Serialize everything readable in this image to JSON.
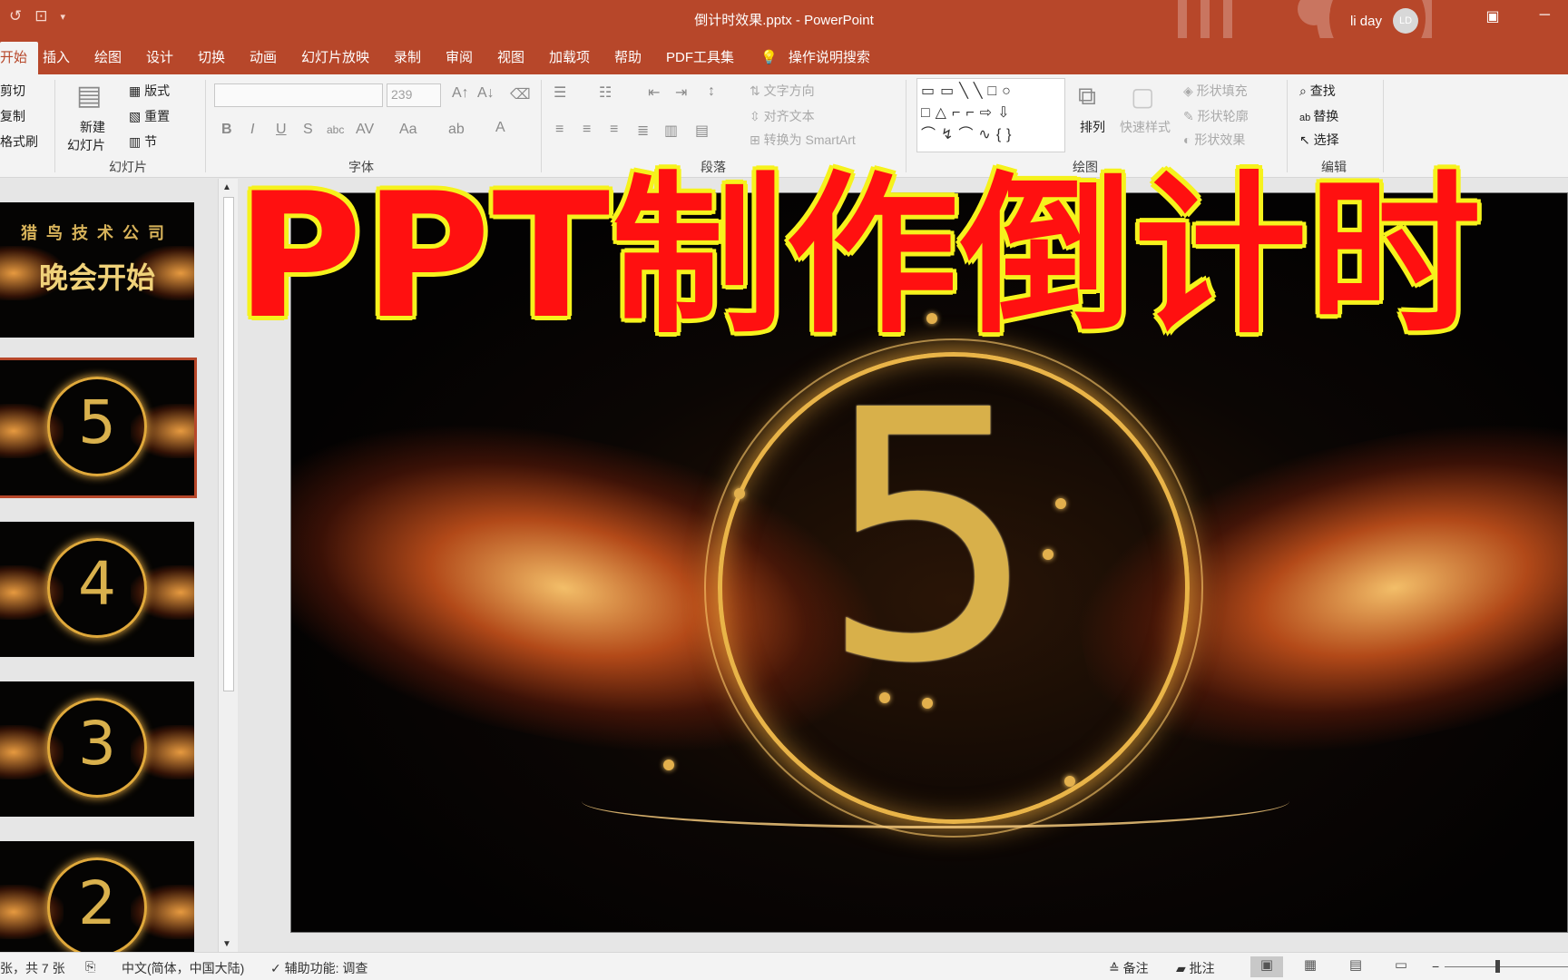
{
  "app": {
    "document_title": "倒计时效果.pptx  -  PowerPoint",
    "user_name": "li day",
    "user_initials": "LD"
  },
  "tabs": [
    "开始",
    "插入",
    "绘图",
    "设计",
    "切换",
    "动画",
    "幻灯片放映",
    "录制",
    "审阅",
    "视图",
    "加载项",
    "帮助",
    "PDF工具集"
  ],
  "tell_me": "操作说明搜索",
  "ribbon": {
    "clipboard": {
      "cut": "剪切",
      "copy": "复制",
      "format_painter": "格式刷"
    },
    "slides": {
      "new_slide_line1": "新建",
      "new_slide_line2": "幻灯片",
      "layout": "版式",
      "reset": "重置",
      "section": "节",
      "group_label": "幻灯片"
    },
    "font": {
      "font_size": "239",
      "group_label": "字体"
    },
    "paragraph": {
      "text_direction": "文字方向",
      "align_text": "对齐文本",
      "convert_smartart": "转换为 SmartArt",
      "group_label": "段落"
    },
    "drawing": {
      "arrange": "排列",
      "quick_styles": "快速样式",
      "shape_fill": "形状填充",
      "shape_outline": "形状轮廓",
      "shape_effects": "形状效果",
      "group_label": "绘图"
    },
    "editing": {
      "find": "查找",
      "replace": "替换",
      "select": "选择",
      "group_label": "编辑"
    }
  },
  "thumbnails": [
    {
      "title_line1": "猎鸟技术公司",
      "title_line2": "晚会开始"
    },
    {
      "number": "5"
    },
    {
      "number": "4"
    },
    {
      "number": "3"
    },
    {
      "number": "2"
    }
  ],
  "slide": {
    "number": "5"
  },
  "overlay_text": "PPT制作倒计时",
  "status": {
    "slide_count": "张，共 7 张",
    "language": "中文(简体，中国大陆)",
    "accessibility": "辅助功能: 调查",
    "notes": "备注",
    "comments": "批注"
  },
  "colors": {
    "brand": "#b7472a",
    "overlay_text": "#ff1010",
    "overlay_outline": "#f6f21c",
    "gold": "#d8b04a"
  }
}
